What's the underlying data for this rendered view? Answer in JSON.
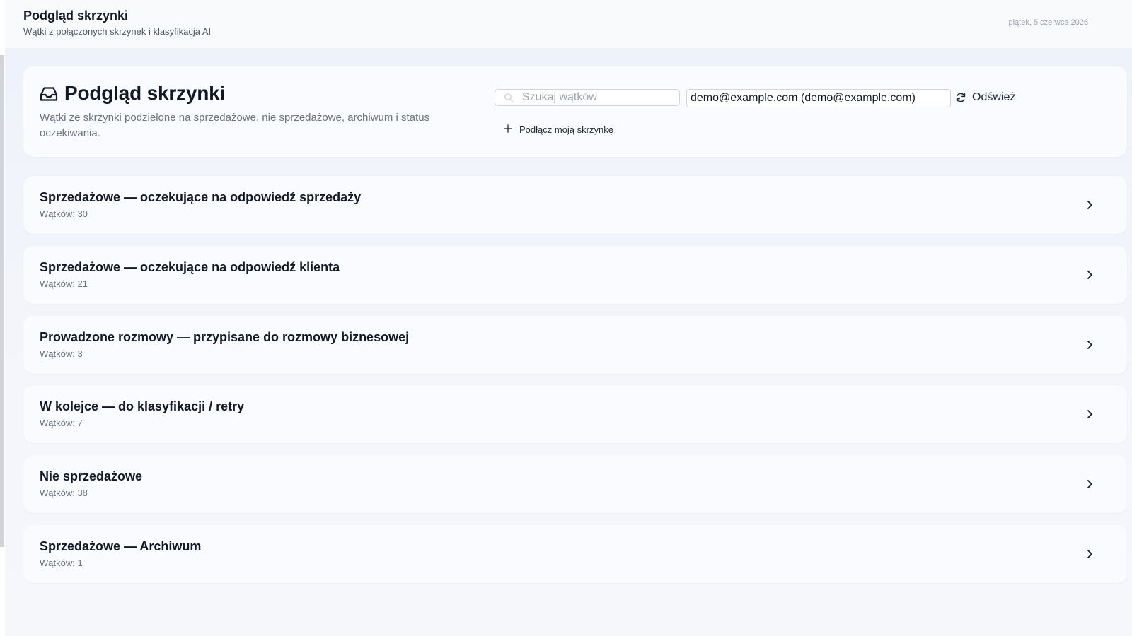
{
  "topbar": {
    "title": "Podgląd skrzynki",
    "subtitle": "Wątki z połączonych skrzynek i klasyfikacja AI",
    "date": "piątek, 5 czerwca 2026"
  },
  "header": {
    "icon": "inbox-icon",
    "title": "Podgląd skrzynki",
    "description": "Wątki ze skrzynki podzielone na sprzedażowe, nie sprzedażowe, archiwum i status oczekiwania."
  },
  "toolbar": {
    "search_placeholder": "Szukaj wątków",
    "search_value": "",
    "account_selected": "demo@example.com (demo@example.com)",
    "refresh_label": "Odśwież",
    "connect_label": "Podłącz moją skrzynkę"
  },
  "categories": [
    {
      "title": "Sprzedażowe — oczekujące na odpowiedź sprzedaży",
      "count_label": "Wątków: 30"
    },
    {
      "title": "Sprzedażowe — oczekujące na odpowiedź klienta",
      "count_label": "Wątków: 21"
    },
    {
      "title": "Prowadzone rozmowy — przypisane do rozmowy biznesowej",
      "count_label": "Wątków: 3"
    },
    {
      "title": "W kolejce — do klasyfikacji / retry",
      "count_label": "Wątków: 7"
    },
    {
      "title": "Nie sprzedażowe",
      "count_label": "Wątków: 38"
    },
    {
      "title": "Sprzedażowe — Archiwum",
      "count_label": "Wątków: 1"
    }
  ],
  "colors": {
    "text_primary": "#111827",
    "text_secondary": "#6b7280",
    "card_background": "#fafbfe",
    "page_background": "#f3f5fb"
  }
}
